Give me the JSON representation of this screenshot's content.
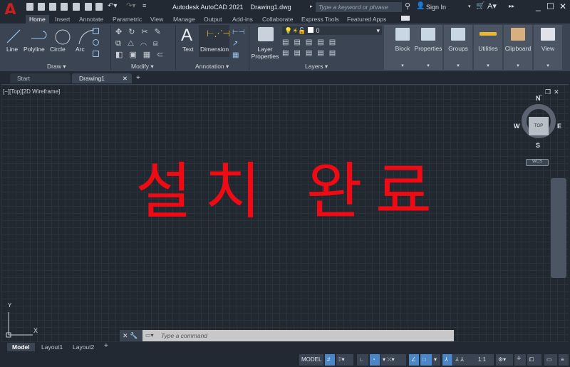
{
  "app": {
    "title": "Autodesk AutoCAD 2021",
    "file": "Drawing1.dwg",
    "logo": "A"
  },
  "search": {
    "placeholder": "Type a keyword or phrase"
  },
  "user": {
    "sign_in": "Sign In"
  },
  "ribbon_tabs": [
    "Home",
    "Insert",
    "Annotate",
    "Parametric",
    "View",
    "Manage",
    "Output",
    "Add-ins",
    "Collaborate",
    "Express Tools",
    "Featured Apps"
  ],
  "draw": {
    "tools": [
      "Line",
      "Polyline",
      "Circle",
      "Arc"
    ],
    "label": "Draw"
  },
  "modify": {
    "label": "Modify"
  },
  "annotation": {
    "tools": [
      "Text",
      "Dimension"
    ],
    "label": "Annotation"
  },
  "layers": {
    "tool": "Layer Properties",
    "current": "0",
    "label": "Layers"
  },
  "big_panels": [
    "Block",
    "Properties",
    "Groups",
    "Utilities",
    "Clipboard",
    "View"
  ],
  "doc_tabs": [
    "Start",
    "Drawing1"
  ],
  "viewport": {
    "label": "[−][Top][2D Wireframe]",
    "message": "설치 완료"
  },
  "viewcube": {
    "top": "TOP",
    "n": "N",
    "s": "S",
    "e": "E",
    "w": "W",
    "wcs": "WCS"
  },
  "ucs": {
    "x": "X",
    "y": "Y"
  },
  "command": {
    "placeholder": "Type a command"
  },
  "layout_tabs": [
    "Model",
    "Layout1",
    "Layout2"
  ],
  "status": {
    "model": "MODEL",
    "scale": "1:1"
  },
  "colors": {
    "accent": "#4a87c8",
    "message": "#f00a14"
  }
}
